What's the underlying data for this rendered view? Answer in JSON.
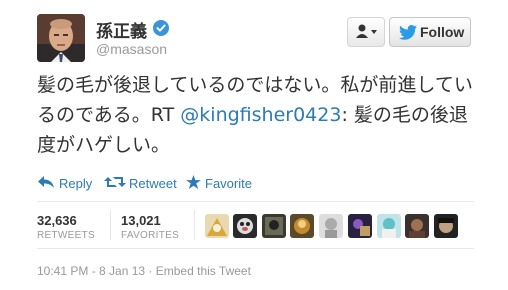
{
  "header": {
    "display_name": "孫正義",
    "handle": "@masason",
    "follow_label": "Follow"
  },
  "tweet": {
    "text_part1": "髪の毛が後退しているのではない。私が前進しているのである。RT ",
    "mention": "@kingfisher0423",
    "text_part2": ": 髪の毛の後退度がハゲしい。"
  },
  "actions": {
    "reply": "Reply",
    "retweet": "Retweet",
    "favorite": "Favorite"
  },
  "stats": {
    "retweets_count": "32,636",
    "retweets_label": "RETWEETS",
    "favorites_count": "13,021",
    "favorites_label": "FAVORITES"
  },
  "favoriters_count_shown": 9,
  "meta": {
    "timestamp": "10:41 PM - 8 Jan 13",
    "separator": " · ",
    "embed": "Embed this Tweet"
  },
  "colors": {
    "link": "#2a7bb8",
    "verified": "#3b94d9",
    "muted": "#999999"
  }
}
